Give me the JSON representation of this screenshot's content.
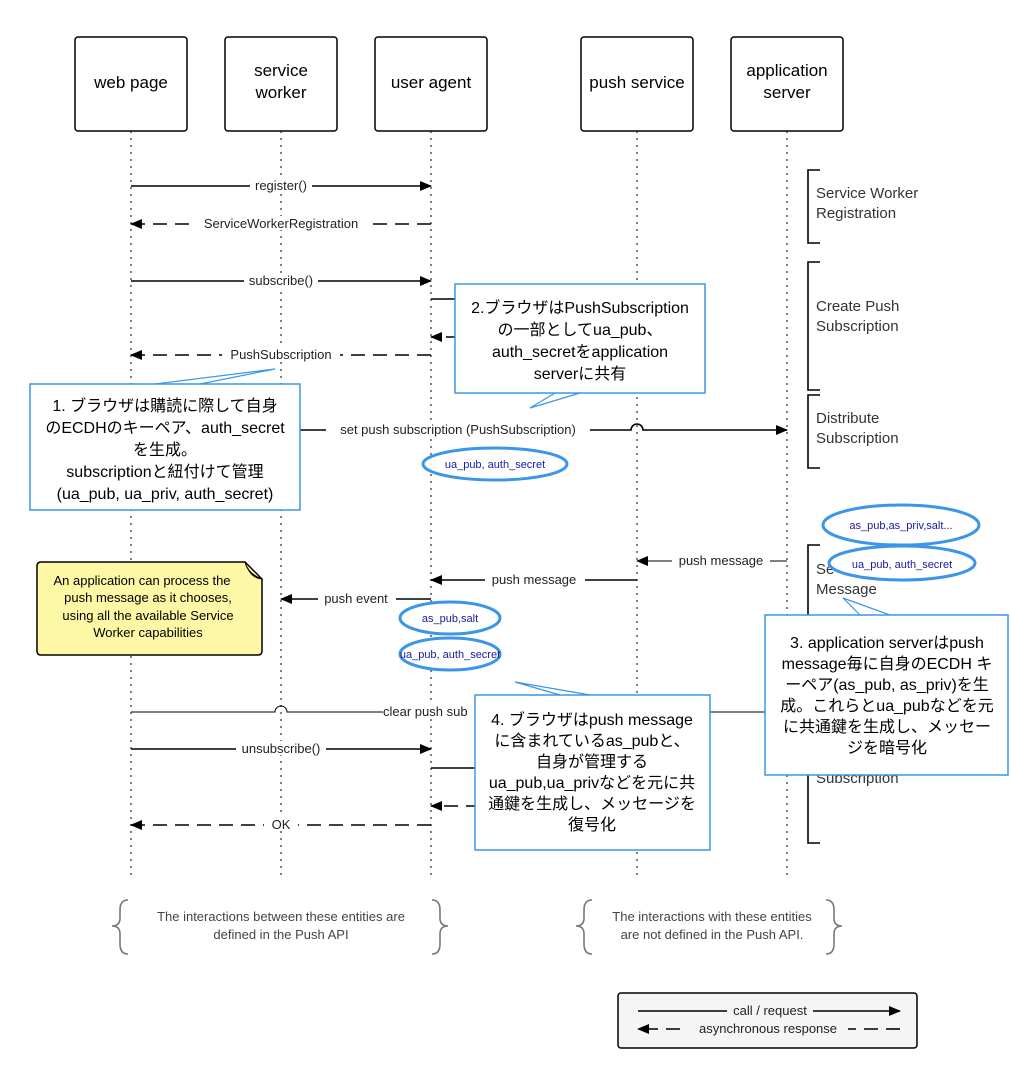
{
  "participants": [
    {
      "lines": [
        "web page"
      ]
    },
    {
      "lines": [
        "service",
        "worker"
      ]
    },
    {
      "lines": [
        "user agent"
      ]
    },
    {
      "lines": [
        "push service"
      ]
    },
    {
      "lines": [
        "application",
        "server"
      ]
    }
  ],
  "messages": {
    "register": "register()",
    "swr": "ServiceWorkerRegistration",
    "subscribe": "subscribe()",
    "push_subscription": "PushSubscription",
    "set_push": "set push subscription (PushSubscription)",
    "push_message_as": "push message",
    "push_message_ps": "push message",
    "push_event": "push event",
    "clear_push": "clear push sub",
    "unsubscribe": "unsubscribe()",
    "ok": "OK"
  },
  "phases": {
    "swr": [
      "Service Worker",
      "Registration"
    ],
    "create": [
      "Create Push",
      "Subscription"
    ],
    "distribute": [
      "Distribute",
      "Subscription"
    ],
    "send": [
      "Se",
      "Message"
    ],
    "unsub": [
      "Subscription"
    ]
  },
  "callouts": {
    "c1": [
      "1. ブラウザは購読に際して自身",
      "のECDHのキーペア、auth_secret",
      "を生成。",
      "subscriptionと紐付けて管理",
      "(ua_pub, ua_priv, auth_secret)"
    ],
    "c2": [
      "2.ブラウザはPushSubscription",
      "の一部としてua_pub、",
      "auth_secretをapplication",
      "serverに共有"
    ],
    "c3": [
      "3. application serverはpush",
      "message毎に自身のECDH キ",
      "ーペア(as_pub, as_priv)を生",
      "成。これらとua_pubなどを元",
      "に共通鍵を生成し、メッセー",
      "ジを暗号化"
    ],
    "c4": [
      "4. ブラウザはpush message",
      "に含まれているas_pubと、",
      "自身が管理する",
      "ua_pub,ua_privなどを元に共",
      "通鍵を生成し、メッセージを",
      "復号化"
    ]
  },
  "ellipses": {
    "e1": "ua_pub, auth_secret",
    "e2": "as_pub,salt",
    "e3": "ua_pub, auth_secret",
    "e4": "as_pub,as_priv,salt...",
    "e5": "ua_pub, auth_secret"
  },
  "note": [
    "An application can process the",
    "push message as it chooses,",
    "using all the available Service",
    "Worker capabilities"
  ],
  "footer": {
    "left": [
      "The interactions between these entities are",
      "defined in the Push API"
    ],
    "right": [
      "The interactions with these entities",
      "are not defined in the Push API."
    ]
  },
  "legend": {
    "call": "call / request",
    "async": "asynchronous response"
  },
  "colors": {
    "callout_border": "#3b95e8",
    "ellipse_text": "#1a1aa0",
    "note_fill": "#fdf7a6"
  }
}
